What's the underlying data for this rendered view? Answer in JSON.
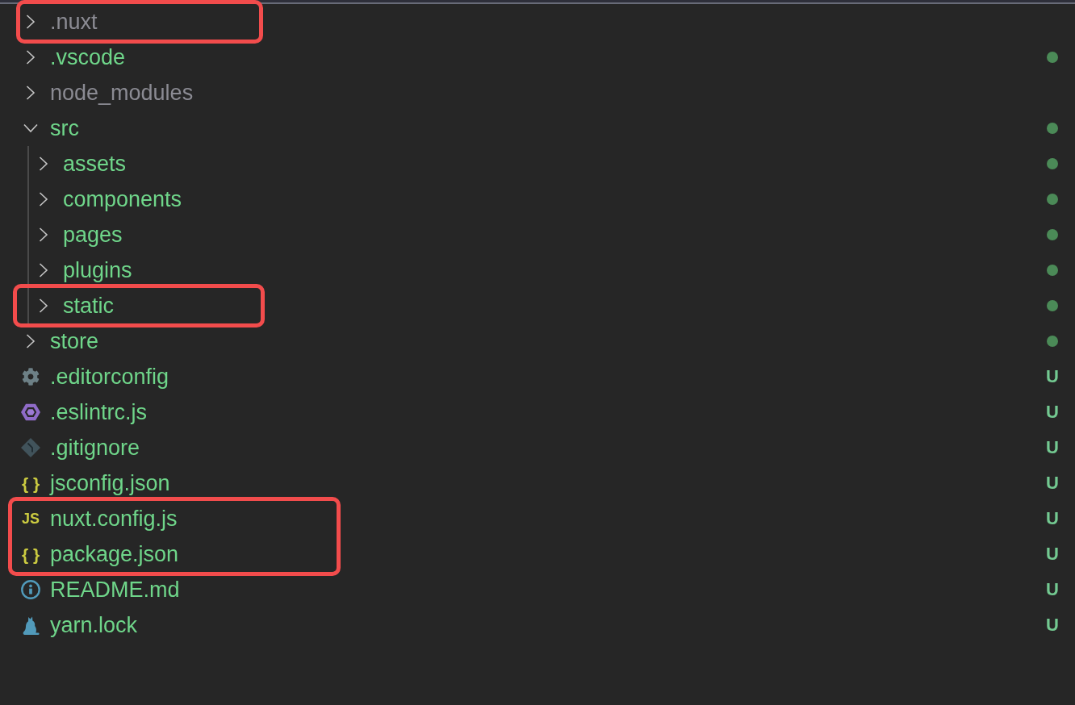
{
  "explorer": {
    "tree": [
      {
        "name": ".nuxt",
        "kind": "folder",
        "expanded": false,
        "ignored": true,
        "changes_dot": false,
        "highlighted": true
      },
      {
        "name": ".vscode",
        "kind": "folder",
        "expanded": false,
        "ignored": false,
        "changes_dot": true,
        "highlighted": false
      },
      {
        "name": "node_modules",
        "kind": "folder",
        "expanded": false,
        "ignored": true,
        "changes_dot": false,
        "highlighted": false
      },
      {
        "name": "src",
        "kind": "folder",
        "expanded": true,
        "ignored": false,
        "changes_dot": true,
        "highlighted": false,
        "children": [
          {
            "name": "assets",
            "kind": "folder",
            "expanded": false,
            "ignored": false,
            "changes_dot": true,
            "highlighted": false
          },
          {
            "name": "components",
            "kind": "folder",
            "expanded": false,
            "ignored": false,
            "changes_dot": true,
            "highlighted": false
          },
          {
            "name": "pages",
            "kind": "folder",
            "expanded": false,
            "ignored": false,
            "changes_dot": true,
            "highlighted": false
          },
          {
            "name": "plugins",
            "kind": "folder",
            "expanded": false,
            "ignored": false,
            "changes_dot": true,
            "highlighted": false
          },
          {
            "name": "static",
            "kind": "folder",
            "expanded": false,
            "ignored": false,
            "changes_dot": true,
            "highlighted": true
          }
        ]
      },
      {
        "name": "store",
        "kind": "folder",
        "expanded": false,
        "ignored": false,
        "changes_dot": true,
        "highlighted": false
      },
      {
        "name": ".editorconfig",
        "kind": "editorconfig",
        "ignored": false,
        "badge": "U",
        "highlighted": false
      },
      {
        "name": ".eslintrc.js",
        "kind": "eslint",
        "ignored": false,
        "badge": "U",
        "highlighted": false
      },
      {
        "name": ".gitignore",
        "kind": "gitignore",
        "ignored": false,
        "badge": "U",
        "highlighted": false
      },
      {
        "name": "jsconfig.json",
        "kind": "json",
        "glyph": "{ }",
        "ignored": false,
        "badge": "U",
        "highlighted": false
      },
      {
        "name": "nuxt.config.js",
        "kind": "javascript",
        "glyph": "JS",
        "ignored": false,
        "badge": "U",
        "highlighted": true
      },
      {
        "name": "package.json",
        "kind": "json",
        "glyph": "{ }",
        "ignored": false,
        "badge": "U",
        "highlighted": true
      },
      {
        "name": "README.md",
        "kind": "markdown",
        "ignored": false,
        "badge": "U",
        "highlighted": false
      },
      {
        "name": "yarn.lock",
        "kind": "yarn",
        "ignored": false,
        "badge": "U",
        "highlighted": false
      }
    ]
  }
}
